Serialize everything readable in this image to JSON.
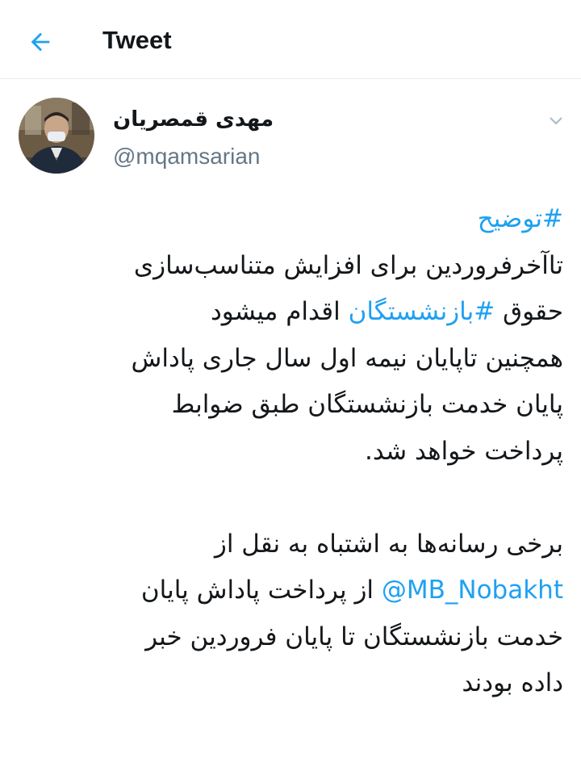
{
  "header": {
    "title": "Tweet",
    "back_icon": "arrow-left-icon"
  },
  "colors": {
    "accent": "#1da1f2",
    "text": "#14171a",
    "secondary": "#657786"
  },
  "author": {
    "display_name": "مهدی قمصریان",
    "handle": "@mqamsarian"
  },
  "tweet": {
    "hashtag_explain": "#توضیح",
    "line1": "تاآخرفروردین برای افزایش متناسب‌سازی",
    "line2_pre": "حقوق ",
    "hashtag_retirees": "#بازنشستگان",
    "line2_post": " اقدام میشود",
    "line3": "همچنین تاپایان نیمه اول سال جاری پاداش",
    "line4": "پایان خدمت بازنشستگان طبق ضوابط",
    "line5": "پرداخت خواهد شد.",
    "line6": "برخی رسانه‌ها به اشتباه به نقل از",
    "mention": "@MB_Nobakht",
    "line7_post": " از پرداخت پاداش پایان",
    "line8": "خدمت بازنشستگان تا پایان فروردین خبر",
    "line9": "داده بودند"
  }
}
